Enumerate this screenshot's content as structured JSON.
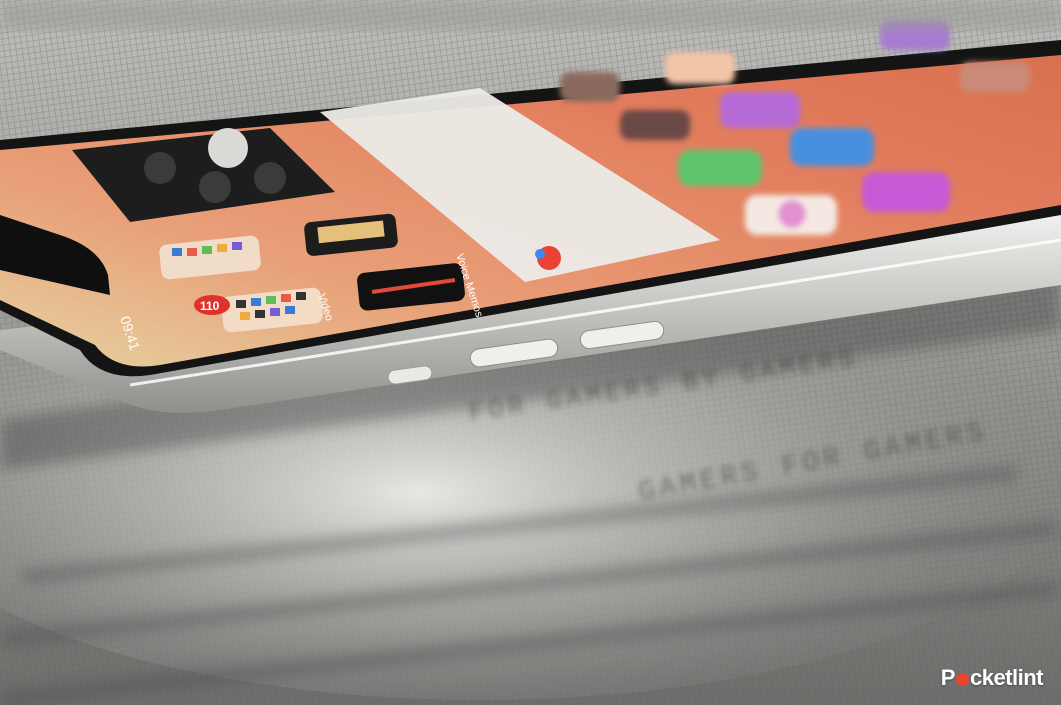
{
  "photo": {
    "subject": "smartphone-on-fabric",
    "screen_wallpaper_color": "#e58a6a",
    "frame_color": "#d9d9d6",
    "fabric_color": "#8f8f8c"
  },
  "screen": {
    "status_time": "09:41",
    "notification_badge": "110",
    "label_video": "Video",
    "label_voice_memos": "Voice Memos"
  },
  "fabric_print": {
    "line_1": "FOR GAMERS BY GAMERS",
    "line_2": "GAMERS FOR GAMERS"
  },
  "watermark": {
    "prefix": "P",
    "suffix": "cketlint",
    "brand_color": "#e8452c"
  }
}
